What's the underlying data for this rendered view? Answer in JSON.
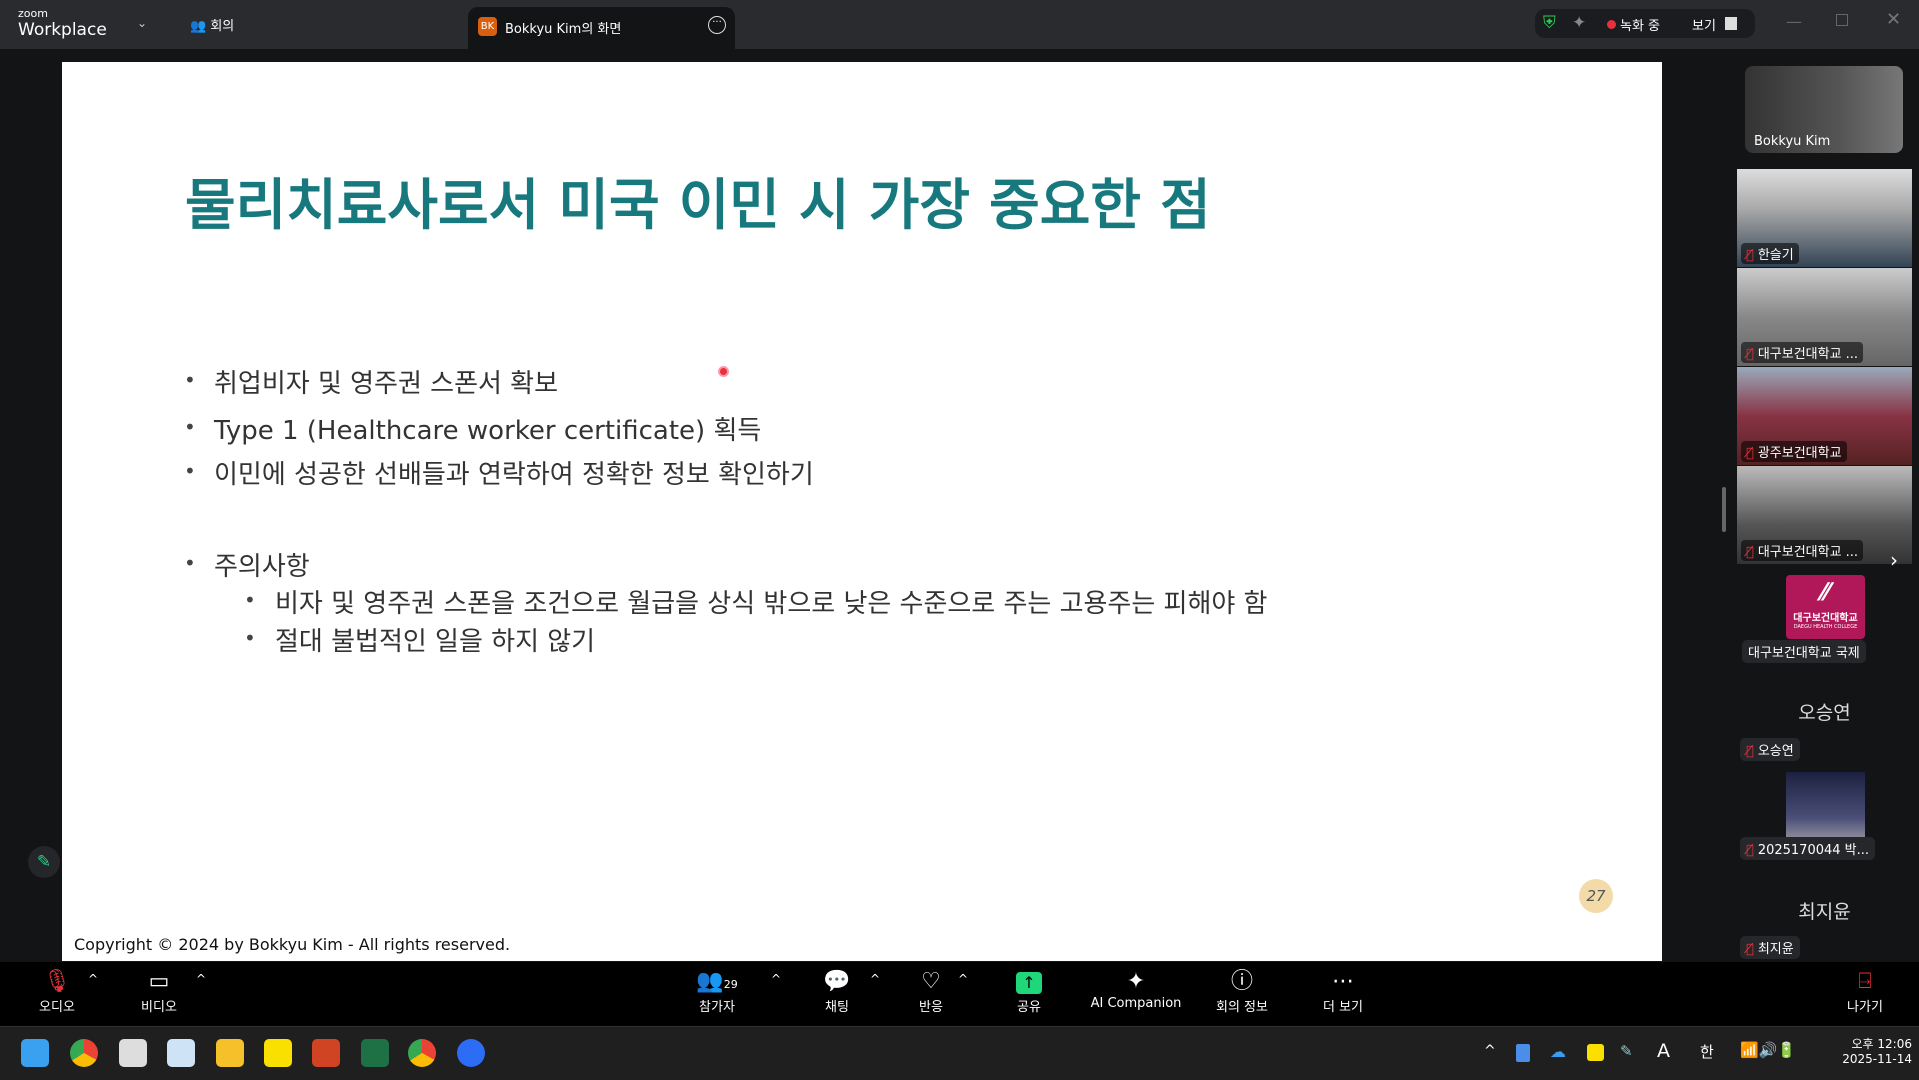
{
  "titlebar": {
    "logo_small": "zoom",
    "logo_big": "Workplace",
    "meeting_label": "회의",
    "tab_badge": "BK",
    "tab_title": "Bokkyu Kim의 화면",
    "recording": "녹화 중",
    "view": "보기"
  },
  "slide": {
    "title": "물리치료사로서 미국 이민 시 가장 중요한 점",
    "bullets": [
      "취업비자 및 영주권 스폰서 확보",
      "Type 1 (Healthcare worker certificate) 획득",
      "이민에 성공한 선배들과 연락하여 정확한 정보 확인하기",
      "주의사항"
    ],
    "sub_bullets": [
      "비자 및 영주권 스폰을 조건으로 월급을 상식 밖으로 낮은 수준으로 주는 고용주는 피해야 함",
      "절대 불법적인 일을 하지 않기"
    ],
    "copyright": "Copyright © 2024 by Bokkyu Kim - All rights reserved.",
    "page_number": "27"
  },
  "participants": {
    "speaker": "Bokkyu Kim",
    "tiles": [
      "한슬기",
      "대구보건대학교 ...",
      "광주보건대학교",
      "대구보건대학교 ..."
    ],
    "logo_text": "대구보건대학교",
    "logo_sub": "DAEGU HEALTH COLLEGE",
    "logo_label": "대구보건대학교 국제",
    "p1_name": "오승연",
    "p1_label": "오승연",
    "p2_label": "2025170044 박...",
    "p3_name": "최지윤",
    "p3_label": "최지윤"
  },
  "toolbar": {
    "audio": "오디오",
    "video": "비디오",
    "participants": "참가자",
    "participants_count": "29",
    "chat": "채팅",
    "reactions": "반응",
    "share": "공유",
    "ai": "AI Companion",
    "info": "회의 정보",
    "more": "더 보기",
    "leave": "나가기"
  },
  "taskbar": {
    "ampm_time": "오후 12:06",
    "date": "2025-11-14",
    "ime": "A"
  },
  "colors": {
    "title": "#17787e",
    "share": "#1fd67a",
    "record": "#e8313a"
  }
}
